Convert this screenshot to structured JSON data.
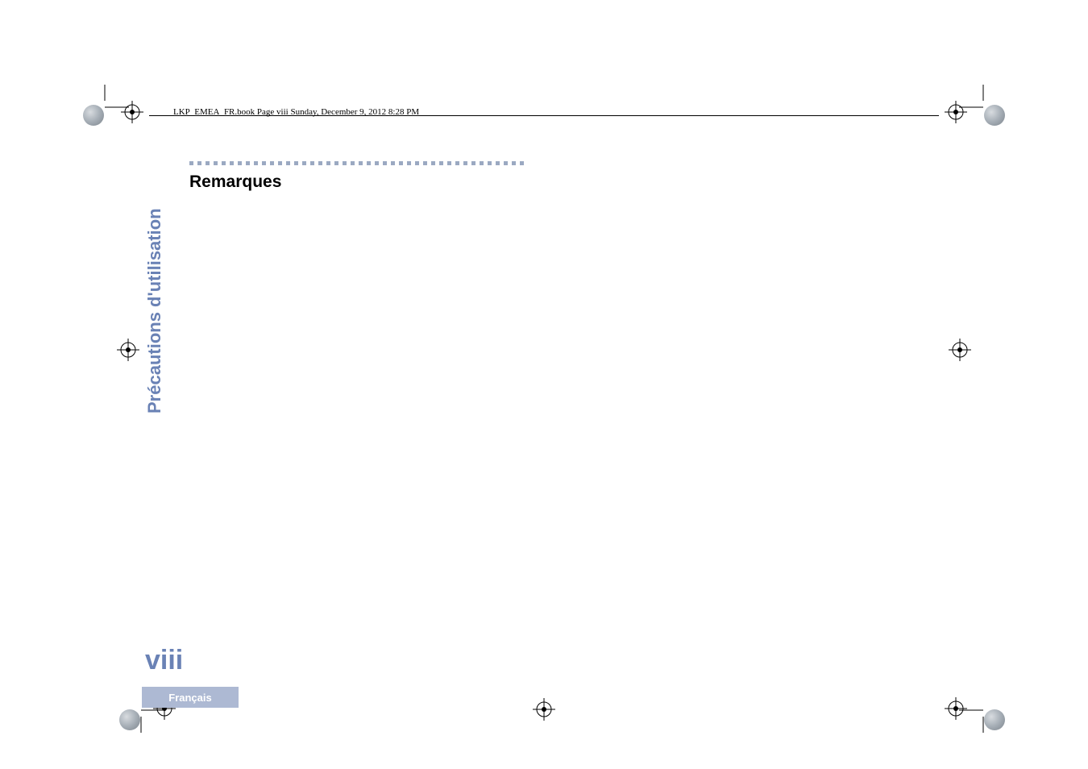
{
  "header": {
    "running_head": "LKP_EMEA_FR.book  Page viii  Sunday, December 9, 2012  8:28 PM"
  },
  "content": {
    "heading": "Remarques"
  },
  "sidebar": {
    "vertical_label": "Précautions d'utilisation"
  },
  "footer": {
    "page_number": "viii",
    "language_tab": "Français"
  }
}
